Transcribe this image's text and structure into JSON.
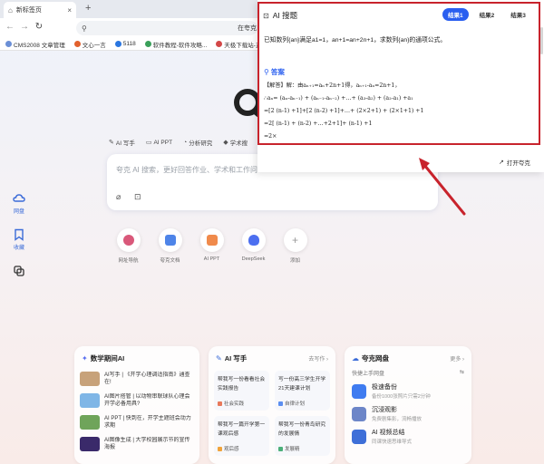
{
  "browser": {
    "tab_title": "新标签页",
    "tab_close": "×",
    "new_tab": "+",
    "nav_back": "←",
    "nav_forward": "→",
    "nav_reload": "↻",
    "address_text": "在夸克",
    "bookmarks": [
      {
        "label": "CMS2008 文章管理",
        "color": "#6b8fd6"
      },
      {
        "label": "文心一言",
        "color": "#e2612d"
      },
      {
        "label": "5118",
        "color": "#2a76e0"
      },
      {
        "label": "软件教程-软件攻略...",
        "color": "#3aa05a"
      },
      {
        "label": "天极下载站-正版软...",
        "color": "#d34848"
      }
    ]
  },
  "rail": [
    {
      "label": "网盘",
      "icon": "cloud-icon"
    },
    {
      "label": "收藏",
      "icon": "bookmark-icon"
    },
    {
      "label": "",
      "icon": "history-icon"
    }
  ],
  "features": [
    {
      "label": "AI 写手",
      "icon": "pen-icon"
    },
    {
      "label": "AI PPT",
      "icon": "ppt-icon"
    },
    {
      "label": "分析研究",
      "icon": "chart-icon"
    },
    {
      "label": "学术搜",
      "icon": "scholar-icon"
    }
  ],
  "search": {
    "placeholder": "夸克 AI 搜索，更好回答作业、学术和工作问"
  },
  "shortcuts": [
    {
      "label": "网址导航",
      "color": "#d9587a"
    },
    {
      "label": "夸克文档",
      "color": "#4e84e8"
    },
    {
      "label": "AI PPT",
      "color": "#f08a4b"
    },
    {
      "label": "DeepSeek",
      "color": "#4c6ff0"
    },
    {
      "label": "添加",
      "color": "#bbbbbb"
    }
  ],
  "card1": {
    "title": "数学期间AI",
    "items": [
      {
        "text": "AI写手 | 《开学心理调适指南》通查在!",
        "color": "#c7a27a"
      },
      {
        "text": "AI图片搭管 | 以动物串联球队心理会开学必备用具?",
        "color": "#7fb6e6"
      },
      {
        "text": "AI PPT | 快到在，开学主题班会动力求期",
        "color": "#6fa45a"
      },
      {
        "text": "AI图像生成 | 大学校园展示节的宣传海报",
        "color": "#3a2a6a"
      }
    ]
  },
  "card2": {
    "title": "AI 写手",
    "more": "去写作 ›",
    "cells": [
      {
        "text": "帮我写一份看看社会实践报告",
        "tag": "社会实践"
      },
      {
        "text": "写一份高三学生开学21天建课计划",
        "tag": "自律计划"
      },
      {
        "text": "帮我写一篇开学第一课观后感",
        "tag": "观后感"
      },
      {
        "text": "帮我写一份青岛研究的发展情",
        "tag": "发展精"
      }
    ]
  },
  "card3": {
    "title": "夸克网盘",
    "more": "更多 ›",
    "sub_left": "快捷上手网盘",
    "sub_right": "⇆",
    "rows": [
      {
        "title": "极速备份",
        "sub": "备份1000张照片只需2分钟",
        "color": "#3f7cf0"
      },
      {
        "title": "沉浸观影",
        "sub": "免费剧集影，流畅播放",
        "color": "#6d86c8"
      },
      {
        "title": "AI 视频总结",
        "sub": "同课快速思维导式",
        "color": "#3e6fd8"
      }
    ]
  },
  "ai_popup": {
    "title": "AI 搜题",
    "tabs": [
      "结果1",
      "结果2",
      "结果3"
    ],
    "question": "已知数列{an}满足a1=1，an+1=an+2n+1，求数列{an}的通项公式。",
    "answer_label": "答案",
    "lines": [
      "【解答】解：由aₙ₊₁=aₙ+2n+1得，aₙ₊₁-aₙ=2n+1，",
      "∴aₙ= (aₙ-aₙ₋₁) + (aₙ₋₁-aₙ₋₂) +…+ (a₃-a₂) + (a₂-a₁) +a₁",
      "=[2 (n-1) +1]+[2 (n-2) +1]+…+ (2×2+1) + (2×1+1) +1",
      "=2[ (n-1) + (n-2) +…+2+1]+ (n-1) +1",
      "=2×"
    ],
    "open_label": "打开夸克",
    "accent": "#2a5ff0",
    "highlight_color": "#c8232c"
  }
}
